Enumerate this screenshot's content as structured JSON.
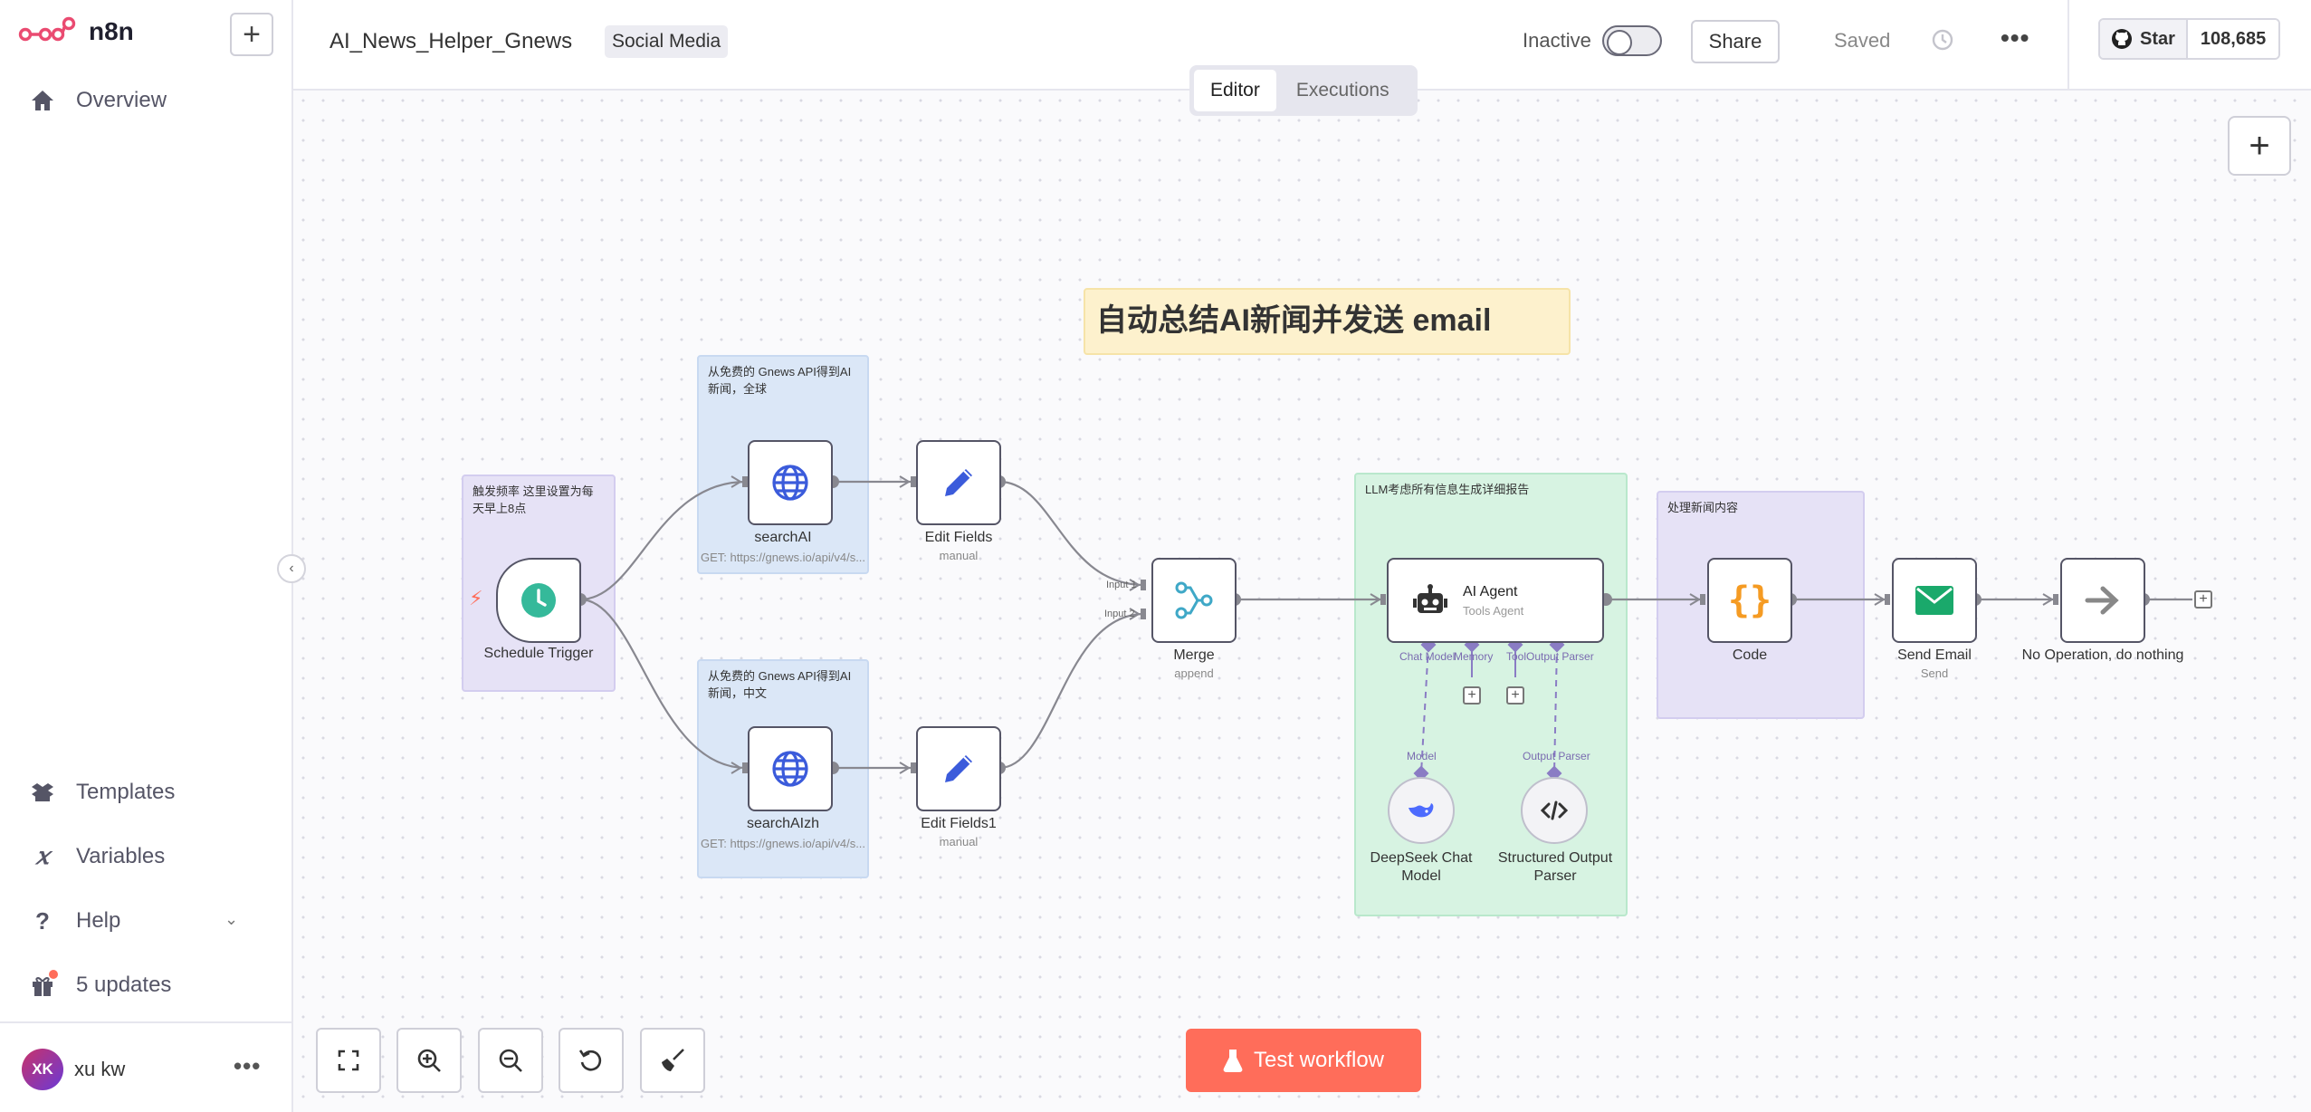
{
  "app": {
    "brand": "n8n"
  },
  "sidebar": {
    "top_items": [
      {
        "label": "Overview",
        "icon": "home-icon"
      }
    ],
    "bottom_items": [
      {
        "label": "Templates",
        "icon": "box-icon"
      },
      {
        "label": "Variables",
        "icon": "variable-icon"
      },
      {
        "label": "Help",
        "icon": "question-icon"
      },
      {
        "label": "5 updates",
        "icon": "gift-icon"
      }
    ],
    "user": {
      "initials": "XK",
      "name": "xu kw"
    }
  },
  "header": {
    "workflow_name": "AI_News_Helper_Gnews",
    "tag": "Social Media",
    "status_label": "Inactive",
    "share_label": "Share",
    "saved_label": "Saved",
    "github": {
      "star_label": "Star",
      "star_count": "108,685"
    },
    "tabs": [
      {
        "label": "Editor",
        "active": true
      },
      {
        "label": "Executions",
        "active": false
      }
    ]
  },
  "canvas": {
    "title_note": "自动总结AI新闻并发送 email",
    "stickies": {
      "trigger": "触发频率 这里设置为每天早上8点",
      "global_news": "从免费的 Gnews API得到AI新闻，全球",
      "zh_news": "从免费的 Gnews API得到AI新闻，中文",
      "llm": "LLM考虑所有信息生成详细报告",
      "process": "处理新闻内容"
    },
    "nodes": {
      "schedule": {
        "label": "Schedule Trigger"
      },
      "search_ai": {
        "label": "searchAI",
        "sub": "GET: https://gnews.io/api/v4/s..."
      },
      "search_ai_zh": {
        "label": "searchAIzh",
        "sub": "GET: https://gnews.io/api/v4/s..."
      },
      "edit_fields": {
        "label": "Edit Fields",
        "sub": "manual"
      },
      "edit_fields1": {
        "label": "Edit Fields1",
        "sub": "manual"
      },
      "merge": {
        "label": "Merge",
        "sub": "append",
        "input1": "Input 1",
        "input2": "Input 2"
      },
      "ai_agent": {
        "title": "AI Agent",
        "sub": "Tools Agent",
        "ports": [
          "Chat Model",
          "Memory",
          "Tool",
          "Output Parser"
        ]
      },
      "deepseek": {
        "label": "DeepSeek Chat Model",
        "port": "Model"
      },
      "parser": {
        "label": "Structured Output Parser",
        "port": "Output Parser"
      },
      "code": {
        "label": "Code"
      },
      "send_email": {
        "label": "Send Email",
        "sub": "Send"
      },
      "noop": {
        "label": "No Operation, do nothing"
      }
    },
    "test_button": "Test workflow"
  },
  "colors": {
    "accent": "#ff6d5a",
    "brand": "#ea4b71",
    "trigger_green": "#35b99a",
    "node_blue": "#3b5bdb",
    "email_green": "#1aa96b",
    "code_orange": "#f59b23"
  }
}
